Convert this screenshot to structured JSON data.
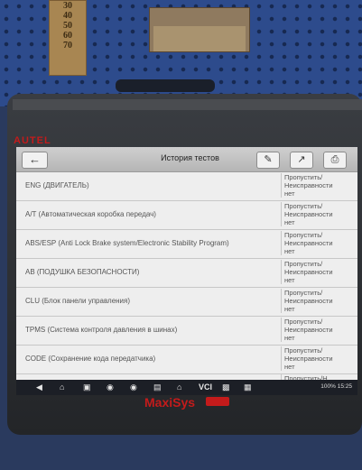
{
  "photo": {
    "gauge_marks": [
      "30",
      "40",
      "50",
      "60",
      "70"
    ],
    "device_brand": "AUTEL",
    "bottom_brand": "MaxiSys"
  },
  "window": {
    "title": "История тестов",
    "back_icon": "back-arrow-icon",
    "toolbar_icons": [
      "edit-icon",
      "share-icon",
      "print-icon"
    ]
  },
  "test_history": [
    {
      "name": "ENG (ДВИГАТЕЛЬ)",
      "status": "Пропустить/Неисправности нет"
    },
    {
      "name": "A/T (Автоматическая коробка передач)",
      "status": "Пропустить/Неисправности нет"
    },
    {
      "name": "ABS/ESP (Anti Lock Brake system/Electronic Stability Program)",
      "status": "Пропустить/Неисправности нет"
    },
    {
      "name": "AB (ПОДУШКА БЕЗОПАСНОСТИ)",
      "status": "Пропустить/Неисправности нет"
    },
    {
      "name": "CLU (Блок панели управления)",
      "status": "Пропустить/Неисправности нет"
    },
    {
      "name": "TPMS (Система контроля давления в шинах)",
      "status": "Пропустить/Неисправности нет"
    },
    {
      "name": "CODE (Сохранение кода передатчика)",
      "status": "Пропустить/Неисправности нет"
    },
    {
      "name": "",
      "status": "Пропустить/Н"
    }
  ],
  "navbar": {
    "icons": [
      "back-icon",
      "home-icon",
      "recent-apps-icon",
      "chrome-icon",
      "camera-icon",
      "screenshot-icon",
      "home-garage-icon",
      "vci-icon",
      "car-icon",
      "shop-icon"
    ],
    "vci_label": "VCI",
    "battery": "100%",
    "time": "15:25"
  }
}
